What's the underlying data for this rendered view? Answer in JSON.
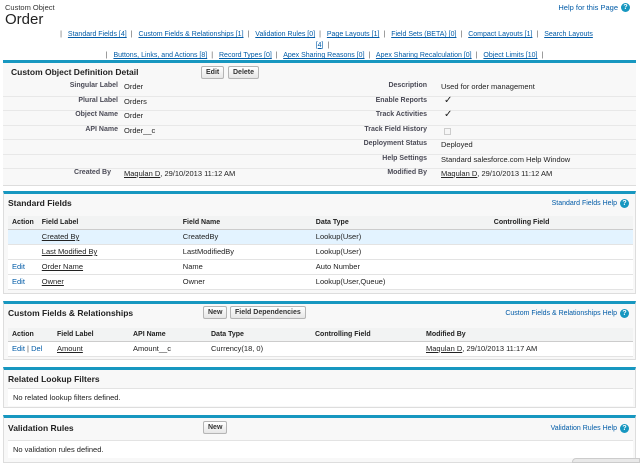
{
  "header": {
    "object_type": "Custom Object",
    "object_name": "Order",
    "help_link": "Help for this Page"
  },
  "jump_links": {
    "line1": [
      "Standard Fields [4]",
      "Custom Fields & Relationships [1]",
      "Validation Rules [0]",
      "Page Layouts [1]",
      "Field Sets (BETA) [0]",
      "Compact Layouts [1]",
      "Search Layouts [4]"
    ],
    "line2": [
      "Buttons, Links, and Actions [8]",
      "Record Types [0]",
      "Apex Sharing Reasons [0]",
      "Apex Sharing Recalculation [0]",
      "Object Limits [10]"
    ]
  },
  "detail": {
    "title": "Custom Object Definition Detail",
    "edit_label": "Edit",
    "delete_label": "Delete",
    "left": [
      {
        "label": "Singular Label",
        "value": "Order"
      },
      {
        "label": "Plural Label",
        "value": "Orders"
      },
      {
        "label": "Object Name",
        "value": "Order"
      },
      {
        "label": "API Name",
        "value": "Order__c"
      }
    ],
    "right": [
      {
        "label": "Description",
        "value": "Used for order management"
      },
      {
        "label": "Enable Reports",
        "value": "✓"
      },
      {
        "label": "Track Activities",
        "value": "✓"
      },
      {
        "label": "Track Field History",
        "value": ""
      },
      {
        "label": "Deployment Status",
        "value": "Deployed"
      },
      {
        "label": "Help Settings",
        "value": "Standard salesforce.com Help Window"
      }
    ],
    "created_by_label": "Created By",
    "created_by_user": "Maqulan D",
    "created_by_date": ", 29/10/2013 11:12 AM",
    "modified_by_label": "Modified By",
    "modified_by_user": "Maqulan D",
    "modified_by_date": ", 29/10/2013 11:12 AM"
  },
  "standard_fields": {
    "title": "Standard Fields",
    "help": "Standard Fields Help",
    "columns": [
      "Action",
      "Field Label",
      "Field Name",
      "Data Type",
      "Controlling Field"
    ],
    "rows": [
      {
        "action": "",
        "label": "Created By",
        "name": "CreatedBy",
        "type": "Lookup(User)",
        "control": ""
      },
      {
        "action": "",
        "label": "Last Modified By",
        "name": "LastModifiedBy",
        "type": "Lookup(User)",
        "control": ""
      },
      {
        "action": "Edit",
        "label": "Order Name",
        "name": "Name",
        "type": "Auto Number",
        "control": ""
      },
      {
        "action": "Edit",
        "label": "Owner",
        "name": "Owner",
        "type": "Lookup(User,Queue)",
        "control": ""
      }
    ]
  },
  "custom_fields": {
    "title": "Custom Fields & Relationships",
    "new_label": "New",
    "deps_label": "Field Dependencies",
    "help": "Custom Fields & Relationships Help",
    "columns": [
      "Action",
      "Field Label",
      "API Name",
      "Data Type",
      "Controlling Field",
      "Modified By"
    ],
    "row": {
      "edit": "Edit",
      "sep": " | ",
      "del": "Del",
      "label": "Amount",
      "api": "Amount__c",
      "type": "Currency(18, 0)",
      "control": "",
      "mod_user": "Maqulan D",
      "mod_date": ", 29/10/2013 11:17 AM"
    }
  },
  "lookup_filters": {
    "title": "Related Lookup Filters",
    "empty": "No related lookup filters defined."
  },
  "validation_rules": {
    "title": "Validation Rules",
    "new_label": "New",
    "help": "Validation Rules Help",
    "empty": "No validation rules defined."
  },
  "help_icon_glyph": "?",
  "colors": {
    "accent": "#1797c0",
    "link": "#015ba7",
    "highlight_row": "#e3f3ff"
  }
}
